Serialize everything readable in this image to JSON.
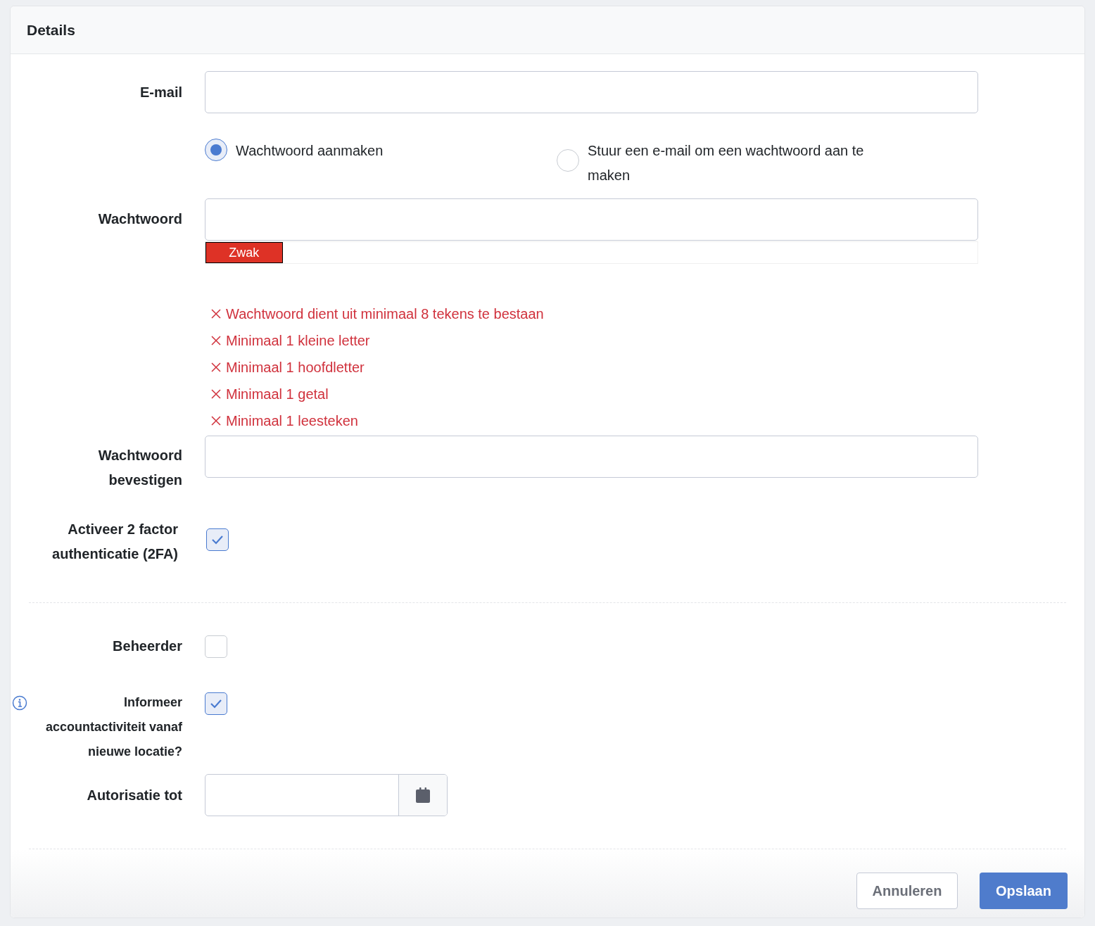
{
  "header": {
    "title": "Details"
  },
  "email": {
    "label": "E-mail"
  },
  "password_mode": [
    {
      "label": "Wachtwoord aanmaken",
      "selected": true
    },
    {
      "label": "Stuur een e-mail om een wachtwoord aan te maken",
      "selected": false
    }
  ],
  "password": {
    "label": "Wachtwoord",
    "strength": {
      "text": "Zwak",
      "level": 0.1
    }
  },
  "rules": [
    {
      "text": "Wachtwoord dient uit minimaal 8 tekens te bestaan",
      "met": false
    },
    {
      "text": "Minimaal 1 kleine letter",
      "met": false
    },
    {
      "text": "Minimaal 1 hoofdletter",
      "met": false
    },
    {
      "text": "Minimaal 1 getal",
      "met": false
    },
    {
      "text": "Minimaal 1 leesteken",
      "met": false
    }
  ],
  "confirm": {
    "label": "Wachtwoord bevestigen"
  },
  "two_factor": {
    "label": "Activeer 2 factor authenticatie (2FA)",
    "checked": true
  },
  "admin": {
    "label": "Beheerder",
    "checked": false
  },
  "notify": {
    "label": "Informeer accountactiviteit vanaf nieuwe locatie?",
    "checked": true
  },
  "authorized_until": {
    "label": "Autorisatie tot"
  },
  "buttons": {
    "cancel": "Annuleren",
    "save": "Opslaan"
  }
}
